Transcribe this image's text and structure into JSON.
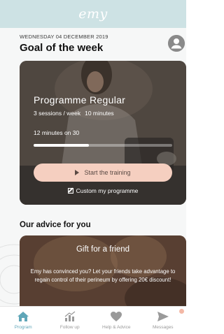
{
  "header": {
    "logo": "emy"
  },
  "main": {
    "date": "WEDNESDAY 04 DECEMBER 2019",
    "title": "Goal of the week",
    "goal_card": {
      "programme_title": "Programme Regular",
      "sessions": "3 sessions / week",
      "duration": "10 minutes",
      "progress_text": "12 minutes on 30",
      "progress_fraction": 0.4,
      "start_label": "Start the training",
      "custom_label": "Custom my programme"
    },
    "advice_section": {
      "title": "Our advice for you",
      "card_title": "Gift for a friend",
      "card_body": "Emy has convinced you? Let your friends take advantage to regain control of their perineum by offering 20€ discount!"
    }
  },
  "tabbar": {
    "items": [
      {
        "label": "Program",
        "icon": "home-icon",
        "active": true
      },
      {
        "label": "Follow up",
        "icon": "bar-chart-icon",
        "active": false
      },
      {
        "label": "Help & Advice",
        "icon": "heart-icon",
        "active": false
      },
      {
        "label": "Messages",
        "icon": "send-icon",
        "active": false
      }
    ]
  },
  "colors": {
    "header_bg": "#cde2e4",
    "accent": "#5fa6b8",
    "button_bg": "#f5cfc0",
    "badge": "#f3b8a6"
  }
}
